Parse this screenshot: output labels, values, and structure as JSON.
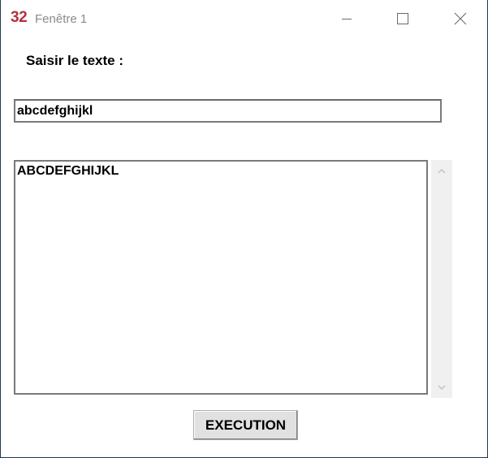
{
  "window": {
    "app_badge": "32",
    "title": "Fenêtre 1",
    "buttons": {
      "minimize": "minimize-icon",
      "maximize": "maximize-icon",
      "close": "close-icon"
    }
  },
  "form": {
    "label": "Saisir le texte :",
    "input_value": "abcdefghijkl",
    "output_value": "ABCDEFGHIJKL",
    "execute_label": "EXECUTION"
  },
  "colors": {
    "badge": "#b5303f",
    "title_text": "#8a8a8a",
    "button_face": "#e1e1e1",
    "scrollbar_track": "#f0f0f0"
  }
}
